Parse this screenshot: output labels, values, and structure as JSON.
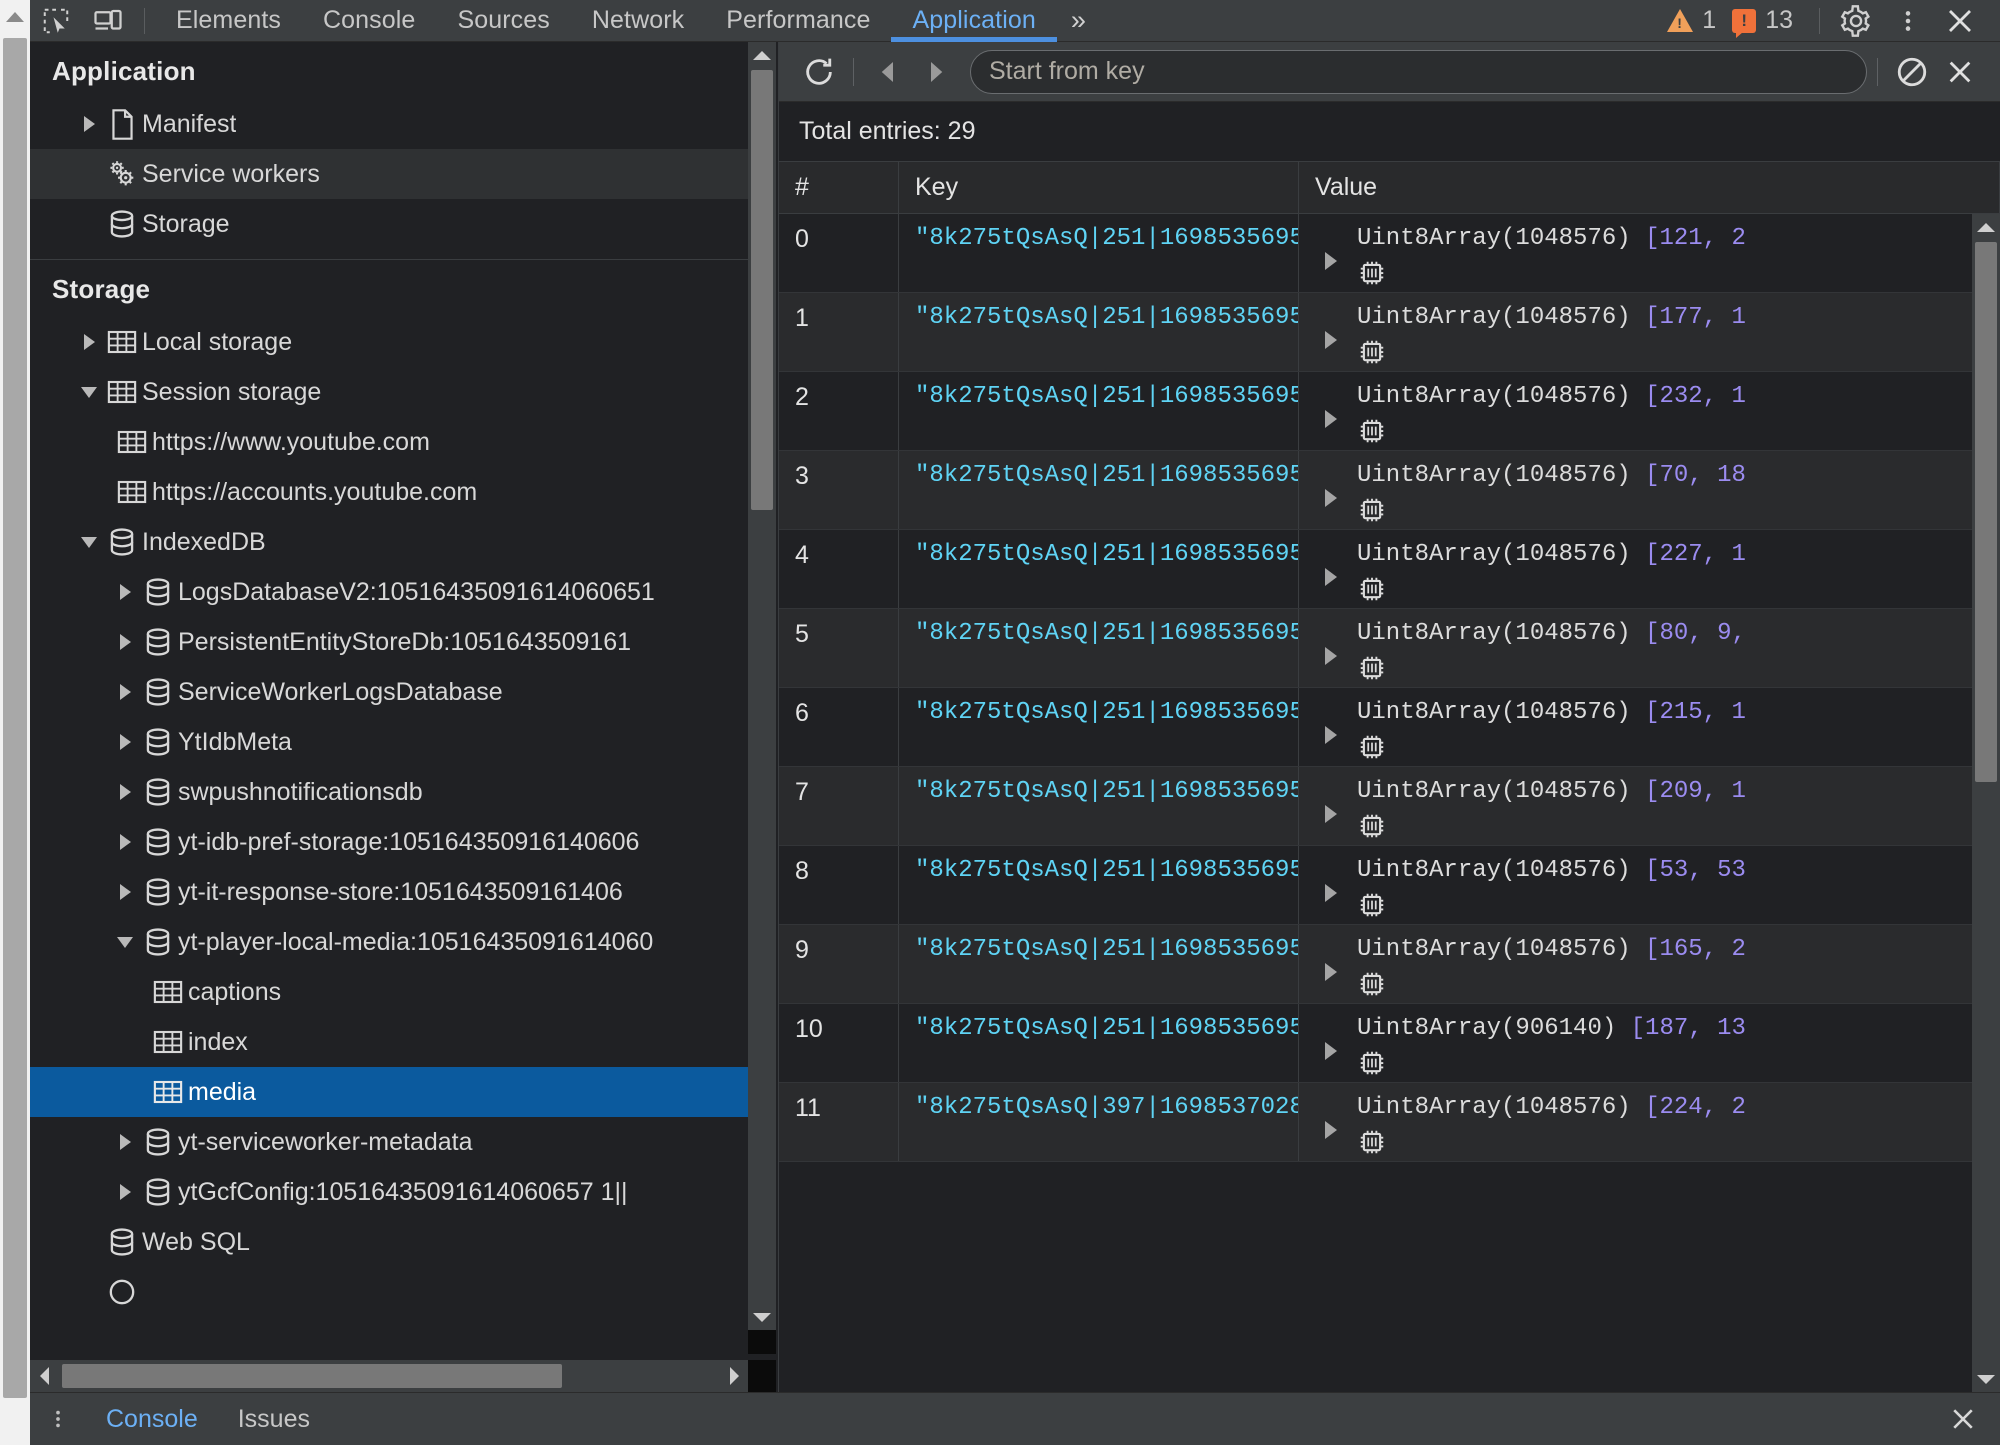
{
  "topbar": {
    "icons": [
      {
        "name": "inspect-element-icon",
        "label": "Inspect element"
      },
      {
        "name": "device-toolbar-icon",
        "label": "Toggle device toolbar"
      }
    ],
    "tabs": [
      {
        "label": "Elements",
        "active": false
      },
      {
        "label": "Console",
        "active": false
      },
      {
        "label": "Sources",
        "active": false
      },
      {
        "label": "Network",
        "active": false
      },
      {
        "label": "Performance",
        "active": false
      },
      {
        "label": "Application",
        "active": true
      }
    ],
    "more_tabs_label": "»",
    "warning_count": "1",
    "error_count": "13",
    "settings_label": "Settings",
    "menu_label": "Customize and control DevTools",
    "close_label": "Close DevTools"
  },
  "sidebar": {
    "application_section": {
      "title": "Application",
      "items": [
        {
          "label": "Manifest",
          "icon": "document-icon",
          "arrow": "right",
          "indent": 1,
          "state": "normal"
        },
        {
          "label": "Service workers",
          "icon": "gears-icon",
          "arrow": "none",
          "indent": 1,
          "state": "hover"
        },
        {
          "label": "Storage",
          "icon": "database-icon",
          "arrow": "none",
          "indent": 1,
          "state": "normal"
        }
      ]
    },
    "storage_section": {
      "title": "Storage",
      "items": [
        {
          "label": "Local storage",
          "icon": "table-icon",
          "arrow": "right",
          "indent": 1,
          "state": "normal"
        },
        {
          "label": "Session storage",
          "icon": "table-icon",
          "arrow": "down",
          "indent": 1,
          "state": "normal"
        },
        {
          "label": "https://www.youtube.com",
          "icon": "table-icon",
          "arrow": "none",
          "indent": 2,
          "state": "normal"
        },
        {
          "label": "https://accounts.youtube.com",
          "icon": "table-icon",
          "arrow": "none",
          "indent": 2,
          "state": "normal"
        },
        {
          "label": "IndexedDB",
          "icon": "database-icon",
          "arrow": "down",
          "indent": 1,
          "state": "normal"
        },
        {
          "label": "LogsDatabaseV2:10516435091614060651",
          "icon": "database-icon",
          "arrow": "right",
          "indent": 2,
          "state": "normal"
        },
        {
          "label": "PersistentEntityStoreDb:1051643509161",
          "icon": "database-icon",
          "arrow": "right",
          "indent": 2,
          "state": "normal"
        },
        {
          "label": "ServiceWorkerLogsDatabase",
          "icon": "database-icon",
          "arrow": "right",
          "indent": 2,
          "state": "normal"
        },
        {
          "label": "YtIdbMeta",
          "icon": "database-icon",
          "arrow": "right",
          "indent": 2,
          "state": "normal"
        },
        {
          "label": "swpushnotificationsdb",
          "icon": "database-icon",
          "arrow": "right",
          "indent": 2,
          "state": "normal"
        },
        {
          "label": "yt-idb-pref-storage:105164350916140606",
          "icon": "database-icon",
          "arrow": "right",
          "indent": 2,
          "state": "normal"
        },
        {
          "label": "yt-it-response-store:1051643509161406",
          "icon": "database-icon",
          "arrow": "right",
          "indent": 2,
          "state": "normal"
        },
        {
          "label": "yt-player-local-media:10516435091614060",
          "icon": "database-icon",
          "arrow": "down",
          "indent": 2,
          "state": "normal"
        },
        {
          "label": "captions",
          "icon": "table-icon",
          "arrow": "none",
          "indent": 3,
          "state": "normal"
        },
        {
          "label": "index",
          "icon": "table-icon",
          "arrow": "none",
          "indent": 3,
          "state": "normal"
        },
        {
          "label": "media",
          "icon": "table-icon",
          "arrow": "none",
          "indent": 3,
          "state": "selected"
        },
        {
          "label": "yt-serviceworker-metadata",
          "icon": "database-icon",
          "arrow": "right",
          "indent": 2,
          "state": "normal"
        },
        {
          "label": "ytGcfConfig:10516435091614060657 1||",
          "icon": "database-icon",
          "arrow": "right",
          "indent": 2,
          "state": "normal"
        },
        {
          "label": "Web SQL",
          "icon": "database-icon",
          "arrow": "none",
          "indent": 1,
          "state": "normal"
        }
      ]
    }
  },
  "idb_toolbar": {
    "refresh_label": "Refresh",
    "prev_label": "Show previous page",
    "next_label": "Show next page",
    "key_placeholder": "Start from key",
    "key_value": "",
    "clear_label": "Clear object store",
    "delete_label": "Delete selected"
  },
  "main": {
    "total_entries_text": "Total entries: 29",
    "columns": [
      "#",
      "Key",
      "Value"
    ],
    "rows": [
      {
        "num": "0",
        "key": "\"8k275tQsAsQ|251|1698535695...",
        "value_type": "Uint8Array(1048576)",
        "preview": "[121, 2"
      },
      {
        "num": "1",
        "key": "\"8k275tQsAsQ|251|1698535695...",
        "value_type": "Uint8Array(1048576)",
        "preview": "[177, 1"
      },
      {
        "num": "2",
        "key": "\"8k275tQsAsQ|251|1698535695...",
        "value_type": "Uint8Array(1048576)",
        "preview": "[232, 1"
      },
      {
        "num": "3",
        "key": "\"8k275tQsAsQ|251|1698535695...",
        "value_type": "Uint8Array(1048576)",
        "preview": "[70, 18"
      },
      {
        "num": "4",
        "key": "\"8k275tQsAsQ|251|1698535695...",
        "value_type": "Uint8Array(1048576)",
        "preview": "[227, 1"
      },
      {
        "num": "5",
        "key": "\"8k275tQsAsQ|251|1698535695...",
        "value_type": "Uint8Array(1048576)",
        "preview": "[80, 9,"
      },
      {
        "num": "6",
        "key": "\"8k275tQsAsQ|251|1698535695...",
        "value_type": "Uint8Array(1048576)",
        "preview": "[215, 1"
      },
      {
        "num": "7",
        "key": "\"8k275tQsAsQ|251|1698535695...",
        "value_type": "Uint8Array(1048576)",
        "preview": "[209, 1"
      },
      {
        "num": "8",
        "key": "\"8k275tQsAsQ|251|1698535695...",
        "value_type": "Uint8Array(1048576)",
        "preview": "[53, 53"
      },
      {
        "num": "9",
        "key": "\"8k275tQsAsQ|251|1698535695...",
        "value_type": "Uint8Array(1048576)",
        "preview": "[165, 2"
      },
      {
        "num": "10",
        "key": "\"8k275tQsAsQ|251|1698535695...",
        "value_type": "Uint8Array(906140)",
        "preview": "[187, 13"
      },
      {
        "num": "11",
        "key": "\"8k275tQsAsQ|397|1698537028...",
        "value_type": "Uint8Array(1048576)",
        "preview": "[224, 2"
      }
    ]
  },
  "drawer": {
    "menu_label": "More options",
    "tabs": [
      {
        "label": "Console",
        "active": true
      },
      {
        "label": "Issues",
        "active": false
      }
    ],
    "close_label": "Close drawer"
  },
  "colors": {
    "accent_blue": "#6cb0f5",
    "selection_blue": "#0b5a9e",
    "key_cyan": "#5fd4f5",
    "number_purple": "#9b8cf0",
    "warning_orange": "#f0a05a",
    "error_orange": "#f0713a",
    "panel_bg": "#202124",
    "toolbar_bg": "#3c3f41"
  }
}
